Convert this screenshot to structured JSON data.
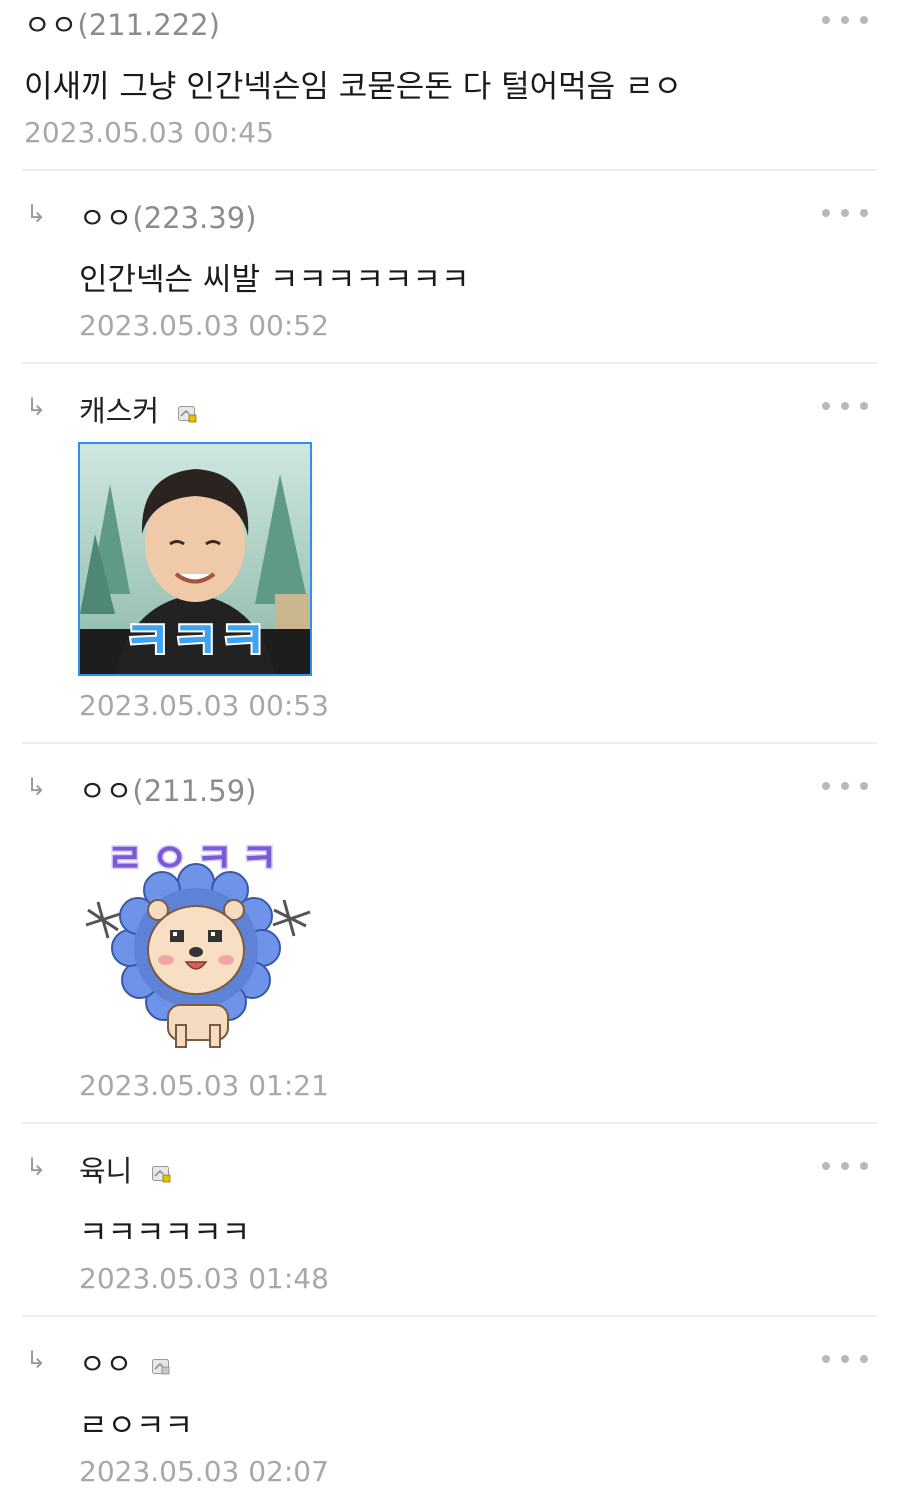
{
  "comments": [
    {
      "author": "ㅇㅇ",
      "ip": "(211.222)",
      "text": "이새끼 그냥 인간넥슨임 코묻은돈 다 털어먹음 ㄹㅇ",
      "date": "2023.05.03 00:45",
      "reply": false
    },
    {
      "author": "ㅇㅇ",
      "ip": "(223.39)",
      "text": "인간넥슨 씨발 ㅋㅋㅋㅋㅋㅋㅋ",
      "date": "2023.05.03 00:52",
      "reply": true
    },
    {
      "author": "캐스커",
      "ip": "",
      "emoticon_text": "ㅋㅋㅋ",
      "date": "2023.05.03 00:53",
      "reply": true,
      "badge": "member-badge-icon"
    },
    {
      "author": "ㅇㅇ",
      "ip": "(211.59)",
      "emoticon_text": "ㄹㅇㅋㅋ",
      "date": "2023.05.03 01:21",
      "reply": true
    },
    {
      "author": "육니",
      "ip": "",
      "text": "ㅋㅋㅋㅋㅋㅋ",
      "date": "2023.05.03 01:48",
      "reply": true,
      "badge": "member-badge-icon"
    },
    {
      "author": "ㅇㅇ",
      "ip": "",
      "text": "ㄹㅇㅋㅋ",
      "date": "2023.05.03 02:07",
      "reply": true,
      "badge": "member-badge-icon"
    }
  ],
  "colors": {
    "ip_gray": "#8c8c8c",
    "date_gray": "#a8a8a8",
    "divider": "#ececec",
    "emoticon_blue": "#2f8ff0"
  }
}
